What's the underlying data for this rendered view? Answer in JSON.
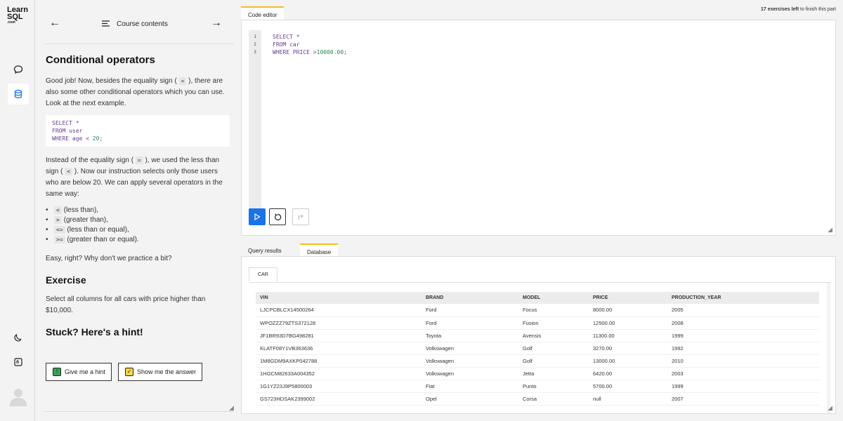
{
  "logo": {
    "line1": "Learn",
    "line2": "SQL",
    "line3": ".com"
  },
  "nav": {
    "back": "←",
    "forward": "→",
    "label": "Course contents"
  },
  "lesson": {
    "title": "Conditional operators",
    "p1a": "Good job! Now, besides the equality sign (",
    "p1code": "=",
    "p1b": "), there are also some other conditional operators which you can use. Look at the next example.",
    "snippet": {
      "l1": "SELECT *",
      "l2": "FROM user",
      "l3a": "WHERE age < ",
      "l3num": "20",
      "l3b": ";"
    },
    "p2a": "Instead of the equality sign (",
    "p2code1": "=",
    "p2b": "), we used the less than sign (",
    "p2code2": "<",
    "p2c": "). Now our instruction selects only those users who are below 20. We can apply several operators in the same way:",
    "ops": [
      {
        "code": "<",
        "text": "(less than),"
      },
      {
        "code": ">",
        "text": "(greater than),"
      },
      {
        "code": "<=",
        "text": "(less than or equal),"
      },
      {
        "code": ">=",
        "text": "(greater than or equal)."
      }
    ],
    "p3": "Easy, right? Why don't we practice a bit?",
    "exercise_title": "Exercise",
    "exercise_text": "Select all columns for all cars with price higher than $10,000.",
    "hint_title": "Stuck? Here's a hint!",
    "btn_hint": "Give me a hint",
    "btn_answer": "Show me the answer"
  },
  "status": {
    "count": "17 exercises left",
    "rest": " to finish this part"
  },
  "editor": {
    "tab": "Code editor",
    "line_numbers": [
      "1",
      "2",
      "3"
    ],
    "l1": "SELECT *",
    "l2": "FROM car",
    "l3a": "WHERE PRICE >",
    "l3num": "10000.00",
    "l3b": ";"
  },
  "results": {
    "tab_query": "Query results",
    "tab_db": "Database",
    "table_tab": "CAR",
    "columns": [
      "VIN",
      "BRAND",
      "MODEL",
      "PRICE",
      "PRODUCTION_YEAR"
    ],
    "rows": [
      [
        "LJCPCBLCX14500264",
        "Ford",
        "Focus",
        "8000.00",
        "2005"
      ],
      [
        "WPOZZZ79ZTS372128",
        "Ford",
        "Fusion",
        "12500.00",
        "2008"
      ],
      [
        "JF1BR93D7BG498281",
        "Toyota",
        "Avensis",
        "11300.00",
        "1999"
      ],
      [
        "KLATF08Y1VB363636",
        "Volkswagen",
        "Golf",
        "3270.00",
        "1992"
      ],
      [
        "1M8GDM9AXKP042788",
        "Volkswagen",
        "Golf",
        "13000.00",
        "2010"
      ],
      [
        "1HGCM82633A004352",
        "Volkswagen",
        "Jetta",
        "6420.00",
        "2003"
      ],
      [
        "1G1YZ23J9P5800003",
        "Fiat",
        "Punto",
        "5700.00",
        "1999"
      ],
      [
        "GS723HDSAK2399002",
        "Opel",
        "Corsa",
        "null",
        "2007"
      ]
    ]
  },
  "colors": {
    "accent": "#1a73e8",
    "tab_highlight": "#f0c020",
    "keyword": "#6b3b8f",
    "number": "#2a8a5a"
  }
}
